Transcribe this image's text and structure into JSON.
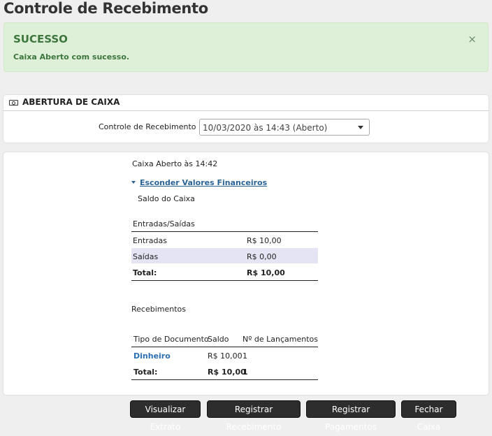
{
  "page": {
    "title": "Controle de Recebimento"
  },
  "alert": {
    "title": "SUCESSO",
    "message": "Caixa Aberto com sucesso.",
    "close": "×"
  },
  "opening_panel": {
    "title": "ABERTURA DE CAIXA",
    "field_label": "Controle de Recebimento",
    "selected_value": "10/03/2020 às 14:43 (Aberto)"
  },
  "summary": {
    "opened_text": "Caixa Aberto às 14:42",
    "toggle_link": "Esconder Valores Financeiros",
    "balance_label": "Saldo do Caixa",
    "flows": {
      "header": "Entradas/Saídas",
      "rows": [
        {
          "label": "Entradas",
          "value": "R$ 10,00"
        },
        {
          "label": "Saídas",
          "value": "R$ 0,00"
        }
      ],
      "total_label": "Total:",
      "total_value": "R$ 10,00"
    },
    "receipts": {
      "title": "Recebimentos",
      "columns": [
        "Tipo de Documento",
        "Saldo",
        "Nº de Lançamentos"
      ],
      "rows": [
        {
          "type": "Dinheiro",
          "balance": "R$ 10,00",
          "count": "1"
        }
      ],
      "total_label": "Total:",
      "total_balance": "R$ 10,00",
      "total_count": "1"
    }
  },
  "actions": {
    "view_statement": "Visualizar Extrato",
    "register_receipt": "Registrar Recebimento",
    "register_payments": "Registrar Pagamentos",
    "close_cash": "Fechar Caixa"
  }
}
